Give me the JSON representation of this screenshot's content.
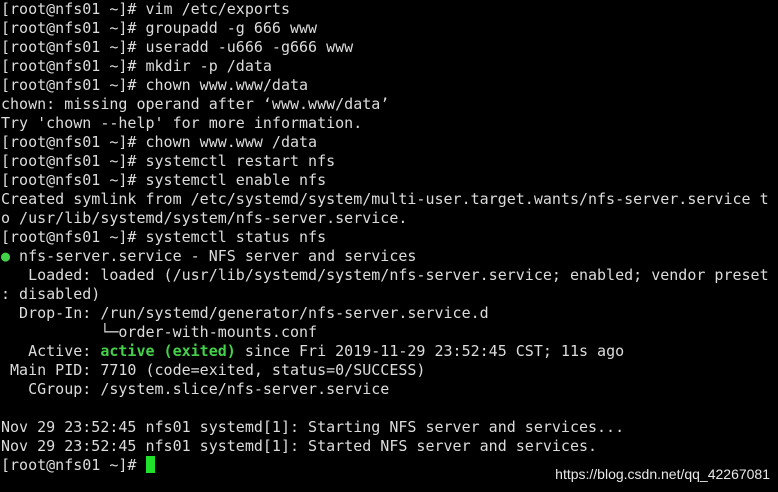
{
  "lines": [
    "[root@nfs01 ~]# vim /etc/exports",
    "[root@nfs01 ~]# groupadd -g 666 www",
    "[root@nfs01 ~]# useradd -u666 -g666 www",
    "[root@nfs01 ~]# mkdir -p /data",
    "[root@nfs01 ~]# chown www.www/data",
    "chown: missing operand after ‘www.www/data’",
    "Try 'chown --help' for more information.",
    "[root@nfs01 ~]# chown www.www /data",
    "[root@nfs01 ~]# systemctl restart nfs",
    "[root@nfs01 ~]# systemctl enable nfs",
    "Created symlink from /etc/systemd/system/multi-user.target.wants/nfs-server.service t",
    "o /usr/lib/systemd/system/nfs-server.service.",
    "[root@nfs01 ~]# systemctl status nfs"
  ],
  "service_dot": "●",
  "service_title": " nfs-server.service - NFS server and services",
  "loaded_line_1": "   Loaded: loaded (/usr/lib/systemd/system/nfs-server.service; enabled; vendor preset",
  "loaded_line_2": ": disabled)",
  "dropin_line_1": "  Drop-In: /run/systemd/generator/nfs-server.service.d",
  "dropin_line_2": "           └─order-with-mounts.conf",
  "active_prefix": "   Active: ",
  "active_state": "active (exited)",
  "active_suffix": " since Fri 2019-11-29 23:52:45 CST; 11s ago",
  "main_pid": " Main PID: 7710 (code=exited, status=0/SUCCESS)",
  "cgroup": "   CGroup: /system.slice/nfs-server.service",
  "log_lines": [
    "Nov 29 23:52:45 nfs01 systemd[1]: Starting NFS server and services...",
    "Nov 29 23:52:45 nfs01 systemd[1]: Started NFS server and services."
  ],
  "final_prompt": "[root@nfs01 ~]# ",
  "watermark": "https://blog.csdn.net/qq_42267081",
  "colors": {
    "background": "#000000",
    "text": "#dcdcdc",
    "active_green": "#44d14a",
    "cursor": "#1fe02a"
  }
}
